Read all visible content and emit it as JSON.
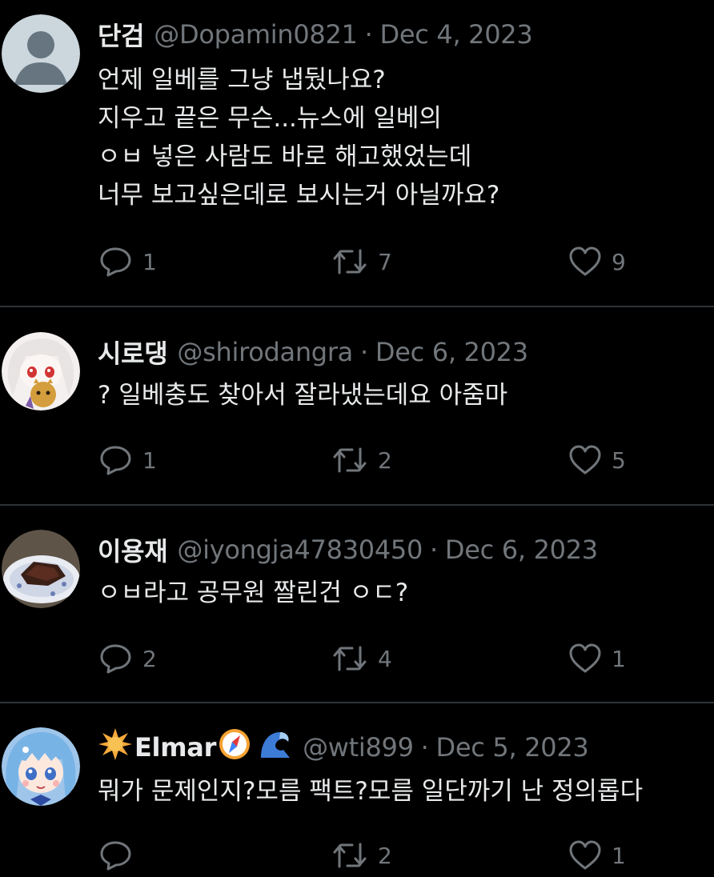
{
  "tweets": [
    {
      "name": "단검",
      "handle": "@Dopamin0821",
      "date": "Dec 4, 2023",
      "lines": [
        "언제 일베를 그냥 냅뒀나요?",
        "지우고 끝은 무슨...뉴스에 일베의",
        "ㅇㅂ 넣은 사람도 바로 해고했었는데",
        "너무 보고싶은데로 보시는거 아닐까요?"
      ],
      "reply_count": "1",
      "retweet_count": "7",
      "like_count": "9"
    },
    {
      "name": "시로댕",
      "handle": "@shirodangra",
      "date": "Dec 6, 2023",
      "lines": [
        "? 일베충도 찾아서 잘라냈는데요 아줌마"
      ],
      "reply_count": "1",
      "retweet_count": "2",
      "like_count": "5"
    },
    {
      "name": "이용재",
      "handle": "@iyongja47830450",
      "date": "Dec 6, 2023",
      "lines": [
        "ㅇㅂ라고 공무원 짤린건 ㅇㄷ?"
      ],
      "reply_count": "2",
      "retweet_count": "4",
      "like_count": "1"
    },
    {
      "name": "Elmar",
      "handle": "@wti899",
      "date": "Dec 5, 2023",
      "lines": [
        "뭐가 문제인지?모름 팩트?모름 일단까기 난 정의롭다"
      ],
      "reply_count": "",
      "retweet_count": "2",
      "like_count": "1"
    }
  ],
  "separator": "·",
  "icons": {
    "reply": "reply-bubble-icon",
    "retweet": "retweet-icon",
    "like": "heart-icon"
  },
  "colors": {
    "background": "#000000",
    "text": "#e7e9ea",
    "muted": "#71767b",
    "divider": "#2f3336"
  }
}
